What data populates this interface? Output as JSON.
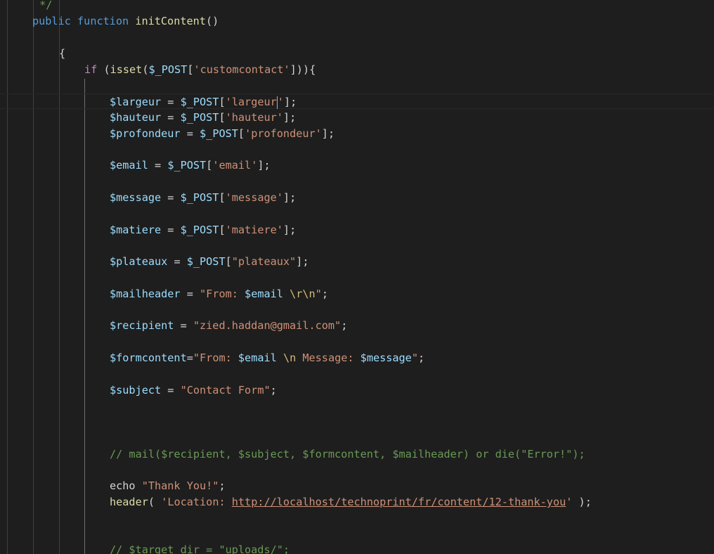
{
  "editor": {
    "lines": [
      [
        {
          "c": "cmt",
          "t": " */"
        }
      ],
      [
        {
          "c": "kw",
          "t": "public"
        },
        {
          "c": "pun",
          "t": " "
        },
        {
          "c": "kw",
          "t": "function"
        },
        {
          "c": "pun",
          "t": " "
        },
        {
          "c": "fn",
          "t": "initContent"
        },
        {
          "c": "pun",
          "t": "()"
        }
      ],
      [],
      [
        {
          "c": "pun",
          "t": "{"
        }
      ],
      [
        {
          "c": "ctl",
          "t": "if"
        },
        {
          "c": "pun",
          "t": " ("
        },
        {
          "c": "fn",
          "t": "isset"
        },
        {
          "c": "pun",
          "t": "("
        },
        {
          "c": "var",
          "t": "$_POST"
        },
        {
          "c": "pun",
          "t": "["
        },
        {
          "c": "str",
          "t": "'customcontact'"
        },
        {
          "c": "pun",
          "t": "])){"
        }
      ],
      [],
      [
        {
          "c": "var",
          "t": "$largeur"
        },
        {
          "c": "pun",
          "t": " = "
        },
        {
          "c": "var",
          "t": "$_POST"
        },
        {
          "c": "pun",
          "t": "["
        },
        {
          "c": "str",
          "t": "'largeur"
        },
        {
          "c": "cursor",
          "t": ""
        },
        {
          "c": "str",
          "t": "'"
        },
        {
          "c": "pun",
          "t": "];"
        }
      ],
      [
        {
          "c": "var",
          "t": "$hauteur"
        },
        {
          "c": "pun",
          "t": " = "
        },
        {
          "c": "var",
          "t": "$_POST"
        },
        {
          "c": "pun",
          "t": "["
        },
        {
          "c": "str",
          "t": "'hauteur'"
        },
        {
          "c": "pun",
          "t": "];"
        }
      ],
      [
        {
          "c": "var",
          "t": "$profondeur"
        },
        {
          "c": "pun",
          "t": " = "
        },
        {
          "c": "var",
          "t": "$_POST"
        },
        {
          "c": "pun",
          "t": "["
        },
        {
          "c": "str",
          "t": "'profondeur'"
        },
        {
          "c": "pun",
          "t": "];"
        }
      ],
      [],
      [
        {
          "c": "var",
          "t": "$email"
        },
        {
          "c": "pun",
          "t": " = "
        },
        {
          "c": "var",
          "t": "$_POST"
        },
        {
          "c": "pun",
          "t": "["
        },
        {
          "c": "str",
          "t": "'email'"
        },
        {
          "c": "pun",
          "t": "];"
        }
      ],
      [],
      [
        {
          "c": "var",
          "t": "$message"
        },
        {
          "c": "pun",
          "t": " = "
        },
        {
          "c": "var",
          "t": "$_POST"
        },
        {
          "c": "pun",
          "t": "["
        },
        {
          "c": "str",
          "t": "'message'"
        },
        {
          "c": "pun",
          "t": "];"
        }
      ],
      [],
      [
        {
          "c": "var",
          "t": "$matiere"
        },
        {
          "c": "pun",
          "t": " = "
        },
        {
          "c": "var",
          "t": "$_POST"
        },
        {
          "c": "pun",
          "t": "["
        },
        {
          "c": "str",
          "t": "'matiere'"
        },
        {
          "c": "pun",
          "t": "];"
        }
      ],
      [],
      [
        {
          "c": "var",
          "t": "$plateaux"
        },
        {
          "c": "pun",
          "t": " = "
        },
        {
          "c": "var",
          "t": "$_POST"
        },
        {
          "c": "pun",
          "t": "["
        },
        {
          "c": "str",
          "t": "\"plateaux\""
        },
        {
          "c": "pun",
          "t": "];"
        }
      ],
      [],
      [
        {
          "c": "var",
          "t": "$mailheader"
        },
        {
          "c": "pun",
          "t": " = "
        },
        {
          "c": "str",
          "t": "\"From: "
        },
        {
          "c": "var",
          "t": "$email"
        },
        {
          "c": "str",
          "t": " "
        },
        {
          "c": "esc",
          "t": "\\r\\n"
        },
        {
          "c": "str",
          "t": "\""
        },
        {
          "c": "pun",
          "t": ";"
        }
      ],
      [],
      [
        {
          "c": "var",
          "t": "$recipient"
        },
        {
          "c": "pun",
          "t": " = "
        },
        {
          "c": "str",
          "t": "\"zied.haddan@gmail.com\""
        },
        {
          "c": "pun",
          "t": ";"
        }
      ],
      [],
      [
        {
          "c": "var",
          "t": "$formcontent"
        },
        {
          "c": "pun",
          "t": "="
        },
        {
          "c": "str",
          "t": "\"From: "
        },
        {
          "c": "var",
          "t": "$email"
        },
        {
          "c": "str",
          "t": " "
        },
        {
          "c": "esc",
          "t": "\\n"
        },
        {
          "c": "str",
          "t": " Message: "
        },
        {
          "c": "var",
          "t": "$message"
        },
        {
          "c": "str",
          "t": "\""
        },
        {
          "c": "pun",
          "t": ";"
        }
      ],
      [],
      [
        {
          "c": "var",
          "t": "$subject"
        },
        {
          "c": "pun",
          "t": " = "
        },
        {
          "c": "str",
          "t": "\"Contact Form\""
        },
        {
          "c": "pun",
          "t": ";"
        }
      ],
      [],
      [],
      [],
      [
        {
          "c": "cmt",
          "t": "// mail($recipient, $subject, $formcontent, $mailheader) or die(\"Error!\");"
        }
      ],
      [],
      [
        {
          "c": "pun",
          "t": "echo "
        },
        {
          "c": "str",
          "t": "\"Thank You!\""
        },
        {
          "c": "pun",
          "t": ";"
        }
      ],
      [
        {
          "c": "fn",
          "t": "header"
        },
        {
          "c": "pun",
          "t": "( "
        },
        {
          "c": "str",
          "t": "'Location: "
        },
        {
          "c": "link",
          "t": "http://localhost/technoprint/fr/content/12-thank-you"
        },
        {
          "c": "str",
          "t": "'"
        },
        {
          "c": "pun",
          "t": " );"
        }
      ],
      [],
      [],
      [
        {
          "c": "cmt",
          "t": "// $target_dir = \"uploads/\";"
        }
      ]
    ]
  }
}
